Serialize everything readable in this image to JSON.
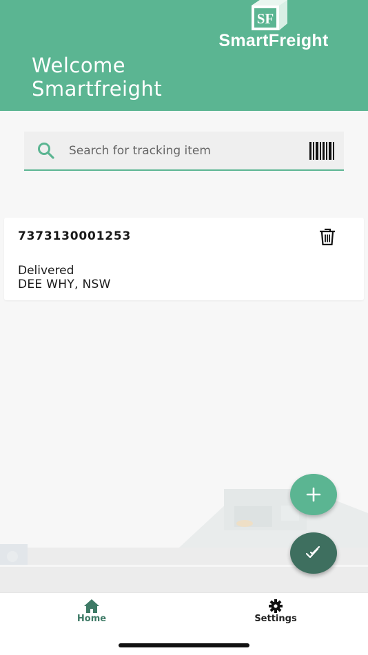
{
  "header": {
    "brand": {
      "logo_letters": "SF",
      "name": "SmartFreight"
    },
    "welcome_line1": "Welcome",
    "welcome_line2": "Smartfreight"
  },
  "search": {
    "placeholder": "Search for tracking item",
    "value": "",
    "icon": "search-icon",
    "scan_icon": "barcode-icon"
  },
  "items": [
    {
      "tracking_number": "7373130001253",
      "status": "Delivered",
      "location": "DEE WHY, NSW",
      "action_icon": "trash-icon"
    }
  ],
  "fabs": {
    "add_icon": "plus-icon",
    "check_icon": "double-check-icon"
  },
  "tabbar": {
    "tabs": [
      {
        "label": "Home",
        "icon": "home-icon",
        "active": true
      },
      {
        "label": "Settings",
        "icon": "gear-icon",
        "active": false
      }
    ]
  },
  "colors": {
    "accent": "#5bb592",
    "accent_dark": "#3e6f5f",
    "active_tab": "#3e7a66",
    "background": "#f7f7f7"
  }
}
